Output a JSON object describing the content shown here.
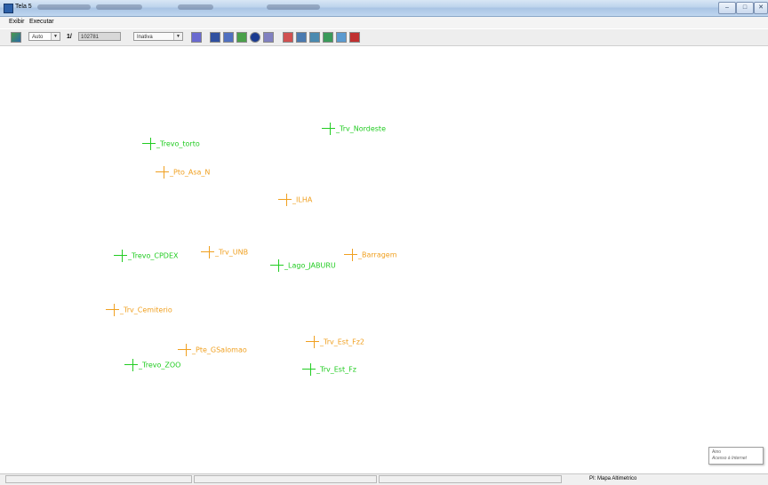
{
  "window": {
    "title": "Tela 5",
    "minimize": "–",
    "maximize": "□",
    "close": "✕"
  },
  "menu": [
    "Exibir",
    "Executar"
  ],
  "toolbar": {
    "scale_mode": "Auto",
    "scale_prefix": "1/",
    "scale_value": "102781",
    "state": "Inativa",
    "icons": [
      "view-icon",
      "panel-icon",
      "select-icon",
      "zoom-in-icon",
      "pan-icon",
      "info-icon",
      "edit-icon",
      "line-icon",
      "query-icon",
      "query2-icon",
      "draw-icon",
      "navigate-icon",
      "home-icon"
    ]
  },
  "map_points": [
    {
      "label": "_Trv_Nordeste",
      "color": "green"
    },
    {
      "label": "_Trevo_torto",
      "color": "green"
    },
    {
      "label": "_Pto_Asa_N",
      "color": "orange"
    },
    {
      "label": "_ILHA",
      "color": "orange"
    },
    {
      "label": "_Trevo_CPDEX",
      "color": "green"
    },
    {
      "label": "_Trv_UNB",
      "color": "orange"
    },
    {
      "label": "_Barragem",
      "color": "orange"
    },
    {
      "label": "_Lago_JABURU",
      "color": "green"
    },
    {
      "label": "_Trv_Cemiterio",
      "color": "orange"
    },
    {
      "label": "_Trv_Est_Fz2",
      "color": "orange"
    },
    {
      "label": "_Pte_GSalomao",
      "color": "orange"
    },
    {
      "label": "_Trevo_ZOO",
      "color": "green"
    },
    {
      "label": "_Trv_Est_Fz",
      "color": "green"
    }
  ],
  "status": {
    "layer": "PI: Mapa Altimetrico"
  },
  "notification": {
    "line1": "Aino",
    "line2": "Acesso à Internet"
  },
  "colors": {
    "green": "#22cc22",
    "orange": "#f0a020"
  }
}
